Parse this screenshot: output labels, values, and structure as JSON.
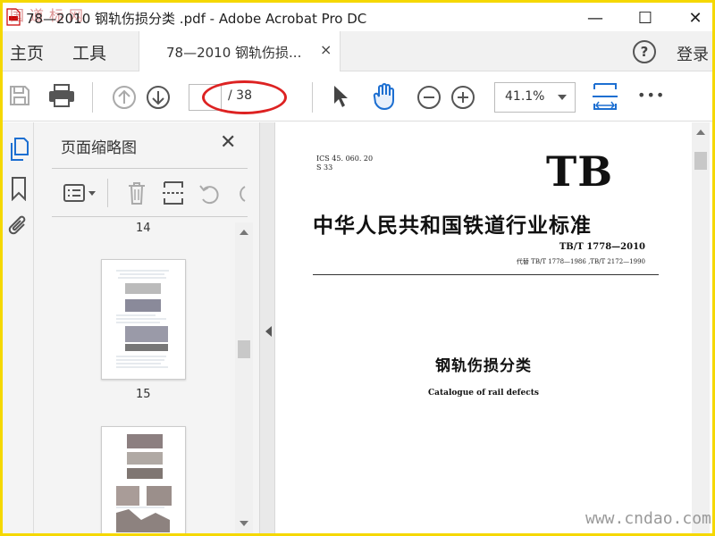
{
  "window": {
    "title": "78—2010  钢轨伤损分类 .pdf - Adobe Acrobat Pro DC",
    "minimize": "—",
    "maximize": "☐",
    "close": "✕",
    "watermark": "国道标网"
  },
  "nav": {
    "home": "主页",
    "tools": "工具",
    "doc_tab": "78—2010  钢轨伤损...",
    "doc_tab_close": "×",
    "help": "?",
    "login": "登录"
  },
  "toolbar": {
    "page_total": "/ 38",
    "zoom": "41.1%",
    "more": "•••"
  },
  "thumbnails": {
    "title": "页面缩略图",
    "close": "✕",
    "pages": [
      "14",
      "15"
    ]
  },
  "document": {
    "ics": "ICS 45. 060. 20",
    "s_code": "S 33",
    "logo": "TB",
    "standard_title": "中华人民共和国铁道行业标准",
    "standard_no": "TB/T 1778—2010",
    "replaces": "代替 TB/T 1778—1986 ,TB/T 2172—1990",
    "title_cn": "钢轨伤损分类",
    "title_en": "Catalogue of rail defects"
  },
  "watermark_bottom": "www.cndao.com"
}
